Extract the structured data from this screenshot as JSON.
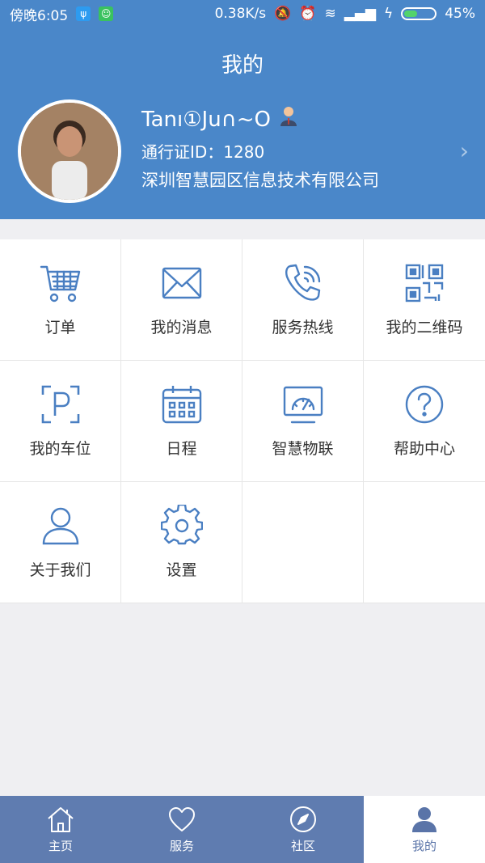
{
  "status": {
    "time": "傍晚6:05",
    "speed": "0.38K/s",
    "battery_text": "45%",
    "battery_level": 0.45
  },
  "header": {
    "title": "我的",
    "username": "Tanı①Ju∩~O",
    "pass_id": "通行证ID：1280",
    "company": "深圳智慧园区信息技术有限公司"
  },
  "grid": [
    {
      "label": "订单",
      "icon": "cart-icon"
    },
    {
      "label": "我的消息",
      "icon": "mail-icon"
    },
    {
      "label": "服务热线",
      "icon": "phone-icon"
    },
    {
      "label": "我的二维码",
      "icon": "qr-icon"
    },
    {
      "label": "我的车位",
      "icon": "parking-icon"
    },
    {
      "label": "日程",
      "icon": "calendar-icon"
    },
    {
      "label": "智慧物联",
      "icon": "gauge-icon"
    },
    {
      "label": "帮助中心",
      "icon": "help-icon"
    },
    {
      "label": "关于我们",
      "icon": "user-icon"
    },
    {
      "label": "设置",
      "icon": "gear-icon"
    }
  ],
  "tabs": [
    {
      "label": "主页",
      "icon": "home-icon",
      "active": false
    },
    {
      "label": "服务",
      "icon": "heart-icon",
      "active": false
    },
    {
      "label": "社区",
      "icon": "compass-icon",
      "active": false
    },
    {
      "label": "我的",
      "icon": "person-icon",
      "active": true
    }
  ],
  "colors": {
    "header": "#4a87c9",
    "icon": "#4a7fc2",
    "tabbar": "#5f7cb0"
  }
}
